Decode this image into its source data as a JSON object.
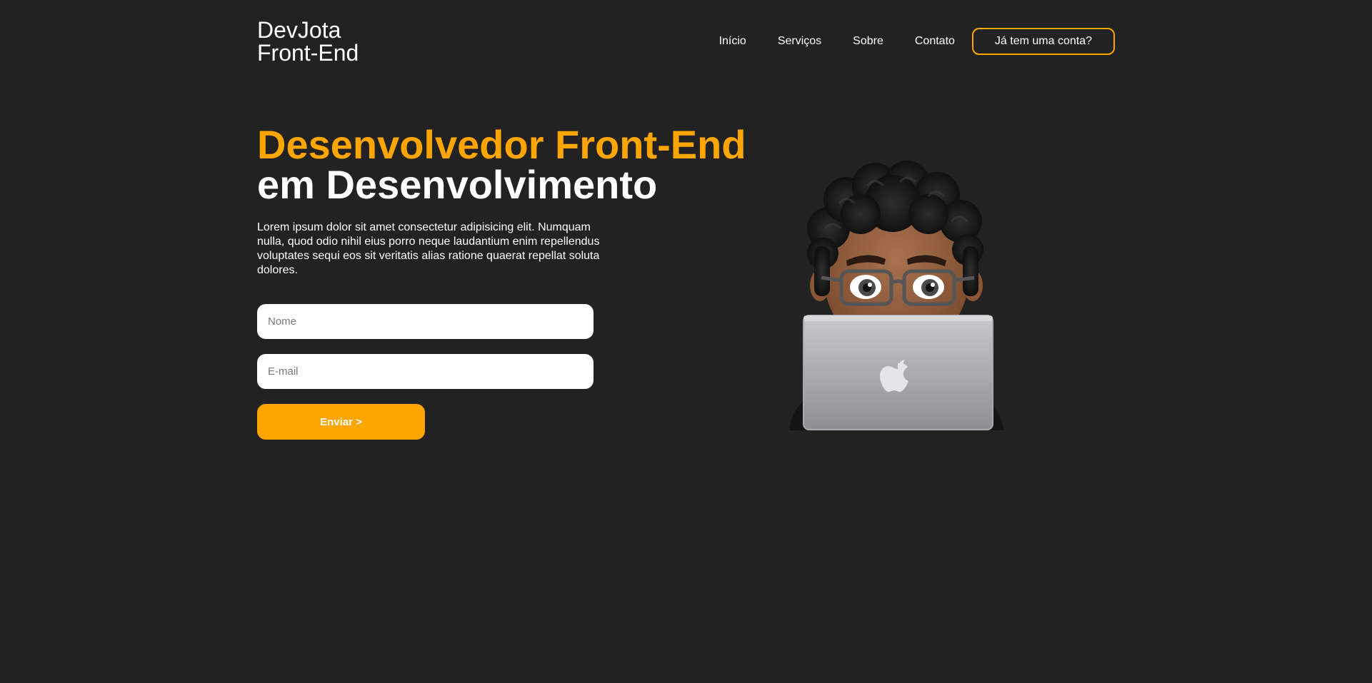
{
  "header": {
    "logo_line1": "DevJota",
    "logo_line2": "Front-End",
    "nav": {
      "inicio": "Início",
      "servicos": "Serviços",
      "sobre": "Sobre",
      "contato": "Contato"
    },
    "login_label": "Já tem uma conta?"
  },
  "hero": {
    "title_line1": "Desenvolvedor Front-End",
    "title_line2": "em Desenvolvimento",
    "description": "Lorem ipsum dolor sit amet consectetur adipisicing elit. Numquam nulla, quod odio nihil eius porro neque laudantium enim repellendus voluptates sequi eos sit veritatis alias ratione quaerat repellat soluta dolores."
  },
  "form": {
    "name_placeholder": "Nome",
    "name_value": "",
    "email_placeholder": "E-mail",
    "email_value": "",
    "submit_label": "Enviar >"
  },
  "illustration": {
    "icon": "memoji-developer-with-laptop",
    "logo_icon": "apple-logo-icon"
  },
  "colors": {
    "background": "#222222",
    "accent": "#ffa500",
    "text": "#ffffff"
  }
}
